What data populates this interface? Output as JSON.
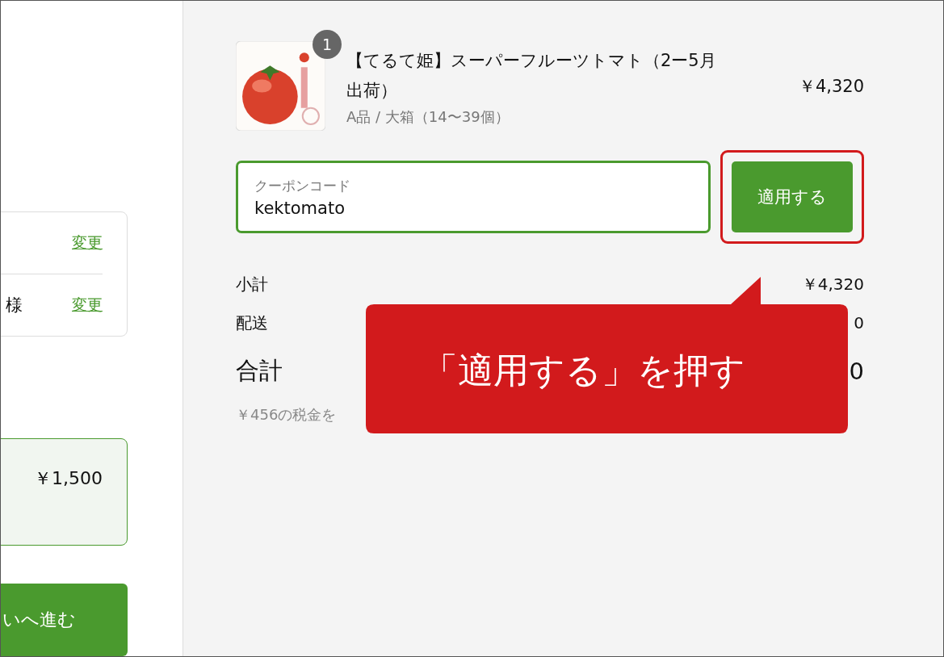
{
  "left_panel": {
    "address_card": {
      "rows": [
        {
          "link": "変更"
        },
        {
          "label": "様",
          "link": "変更"
        }
      ]
    },
    "shipping_option": {
      "price": "￥1,500",
      "selected": true
    },
    "continue_button": "いへ進む"
  },
  "cart_items": [
    {
      "quantity": "1",
      "name": "【てるて姫】スーパーフルーツトマト（2ー5月出荷）",
      "variant": "A品 / 大箱（14〜39個）",
      "price": "￥4,320"
    }
  ],
  "coupon": {
    "label": "クーポンコード",
    "value": "kektomato"
  },
  "apply_button": {
    "label": "適用する",
    "highlighted": true
  },
  "summary": [
    {
      "kind": "row",
      "label": "小計",
      "value": "￥4,320"
    },
    {
      "kind": "row",
      "label": "配送",
      "value": "0"
    },
    {
      "kind": "total",
      "label": "合計",
      "value": "0"
    }
  ],
  "tax_note": "￥456の税金を",
  "callout": "「適用する」を押す"
}
